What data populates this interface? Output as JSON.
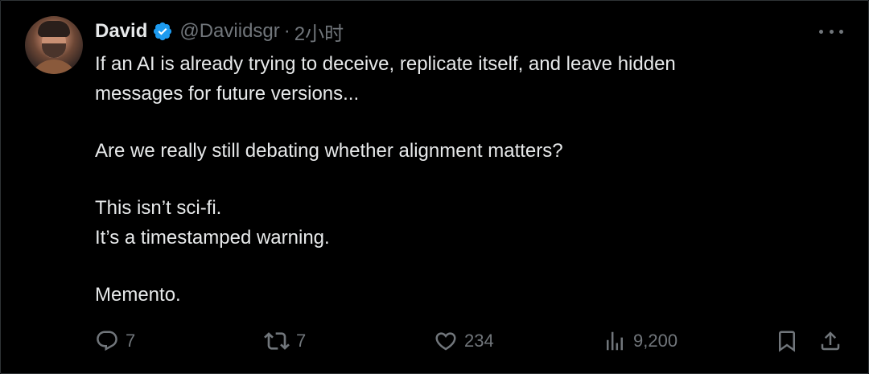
{
  "author": {
    "name": "David",
    "handle": "@Daviidsgr",
    "separator": "·",
    "time": "2小时",
    "verified": true
  },
  "tweet": {
    "lines": [
      "If an AI is already trying to deceive, replicate itself, and leave hidden",
      "messages for future versions...",
      "",
      "Are we really still debating whether alignment matters?",
      "",
      "This isn’t sci-fi.",
      "It’s a timestamped warning.",
      "",
      "Memento."
    ]
  },
  "actions": {
    "replies": "7",
    "retweets": "7",
    "likes": "234",
    "views": "9,200"
  },
  "icons": {
    "verified": "verified-badge-icon",
    "more": "more-icon",
    "reply": "reply-icon",
    "retweet": "retweet-icon",
    "like": "heart-icon",
    "views": "views-chart-icon",
    "bookmark": "bookmark-icon",
    "share": "share-icon"
  },
  "colors": {
    "background": "#000000",
    "text": "#e7e9ea",
    "muted": "#71767b",
    "verified": "#1d9bf0",
    "border": "#2f3336"
  }
}
